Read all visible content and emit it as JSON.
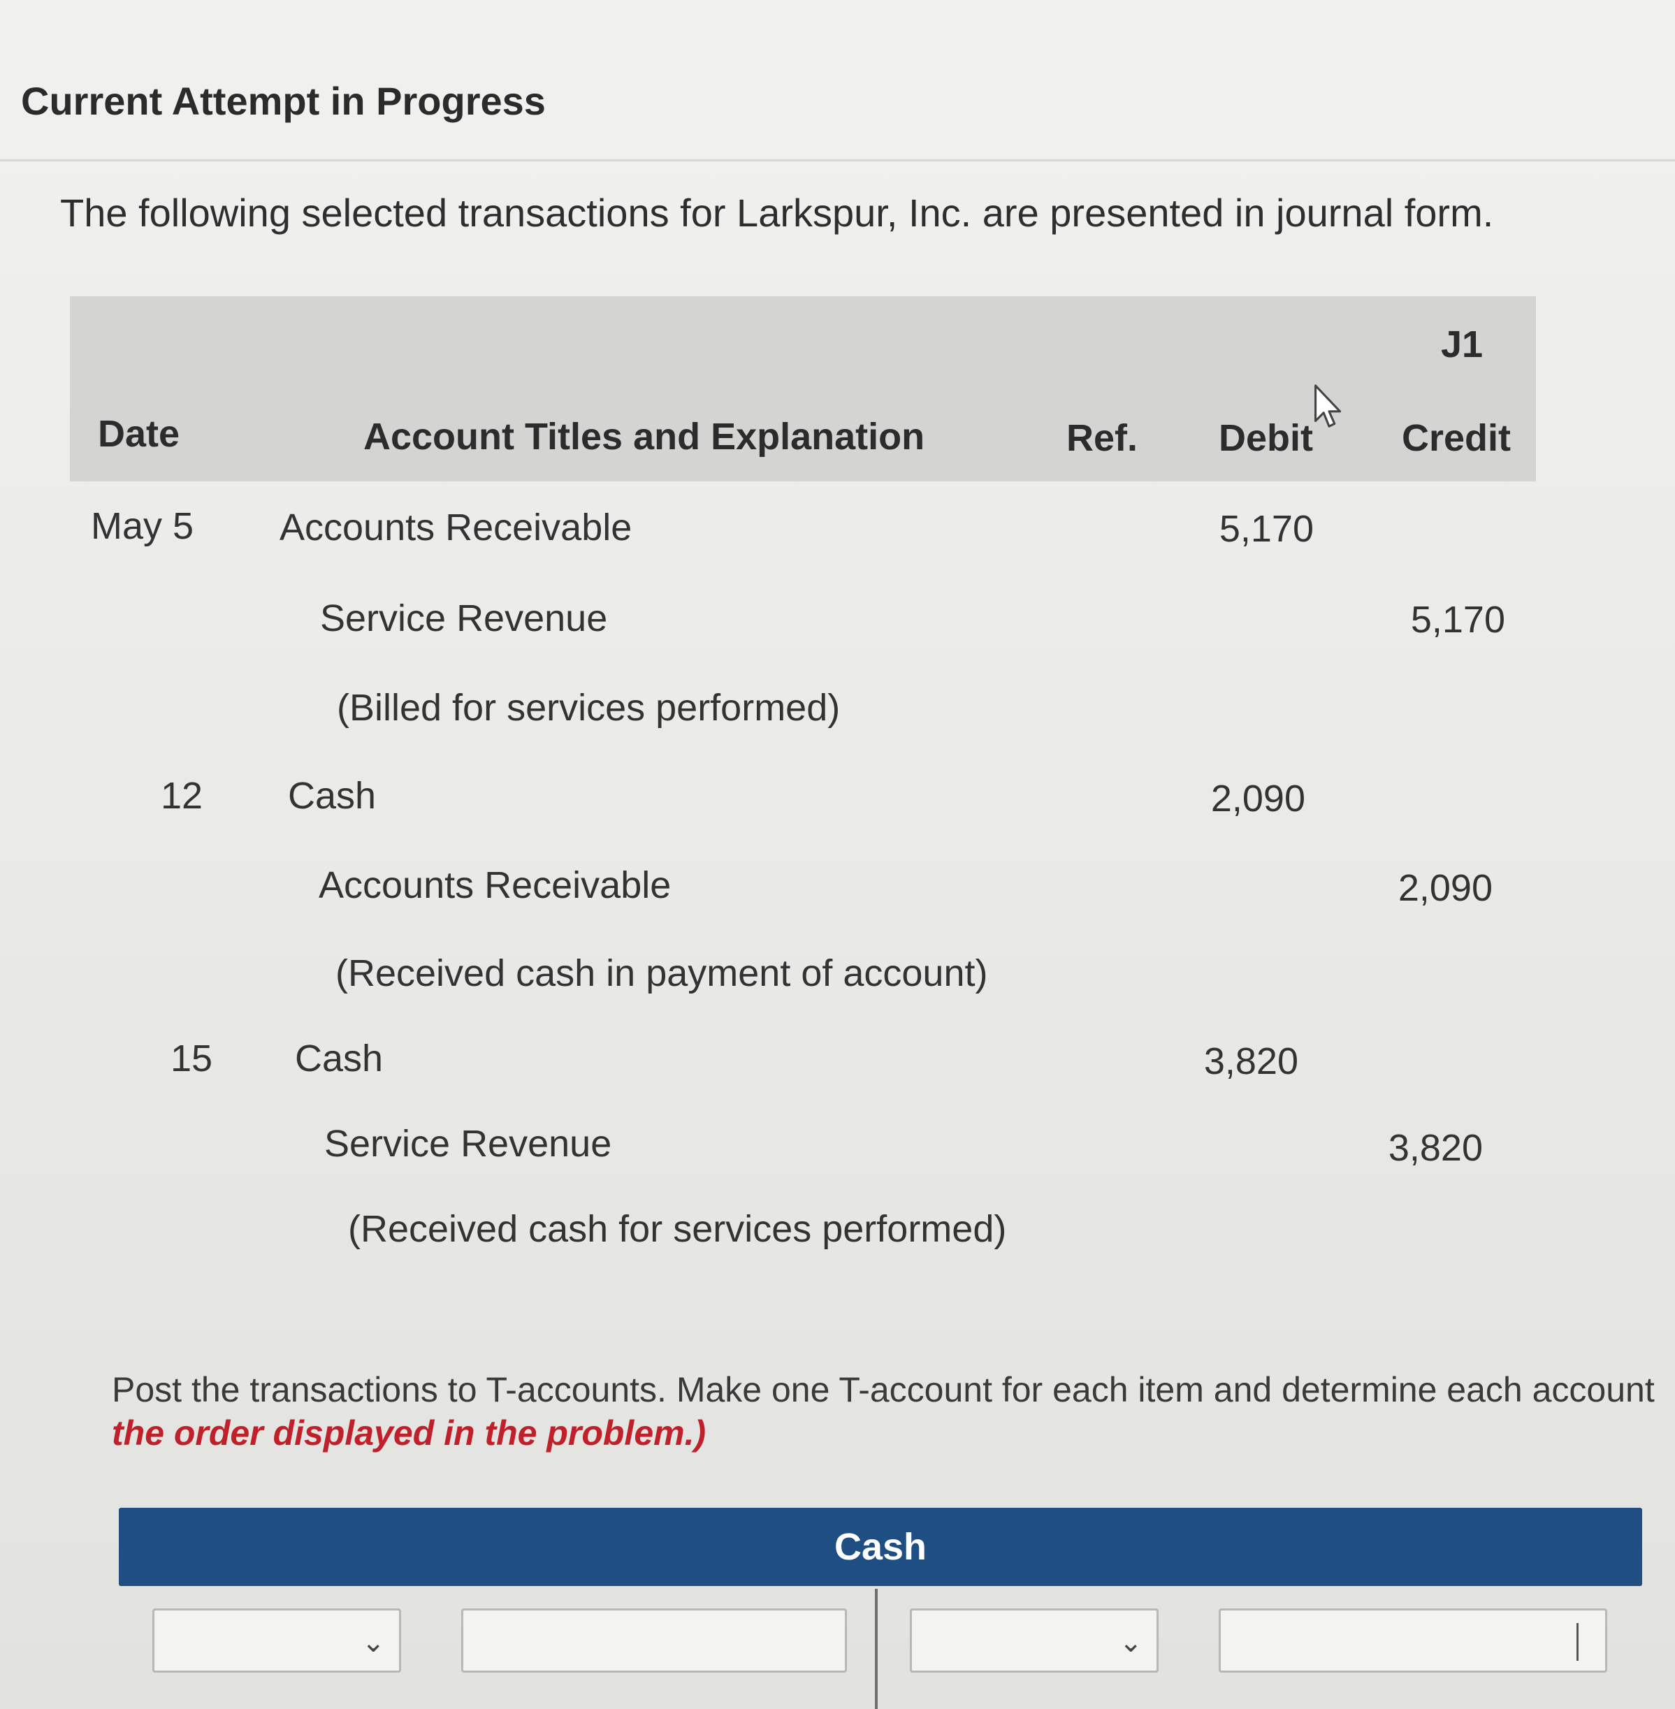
{
  "page": {
    "heading": "Current Attempt in Progress",
    "intro": "The following selected transactions for Larkspur, Inc. are presented in journal form."
  },
  "journal": {
    "page_ref": "J1",
    "headers": {
      "date": "Date",
      "account": "Account Titles and Explanation",
      "ref": "Ref.",
      "debit": "Debit",
      "credit": "Credit"
    },
    "rows": [
      {
        "date": "May 5",
        "account": "Accounts Receivable",
        "debit": "5,170",
        "credit": ""
      },
      {
        "date": "",
        "account": "Service Revenue",
        "debit": "",
        "credit": "5,170"
      },
      {
        "date": "",
        "account": "(Billed for services performed)",
        "debit": "",
        "credit": ""
      },
      {
        "date": "12",
        "account": "Cash",
        "debit": "2,090",
        "credit": ""
      },
      {
        "date": "",
        "account": "Accounts Receivable",
        "debit": "",
        "credit": "2,090"
      },
      {
        "date": "",
        "account": "(Received cash in payment of account)",
        "debit": "",
        "credit": ""
      },
      {
        "date": "15",
        "account": "Cash",
        "debit": "3,820",
        "credit": ""
      },
      {
        "date": "",
        "account": "Service Revenue",
        "debit": "",
        "credit": "3,820"
      },
      {
        "date": "",
        "account": "(Received cash for services performed)",
        "debit": "",
        "credit": ""
      }
    ]
  },
  "instruction": {
    "text": "Post the transactions to T-accounts. Make one T-account for each item and determine each account",
    "emphasis": "the order displayed in the problem.)"
  },
  "taccount": {
    "title": "Cash",
    "left_select_value": "",
    "left_amount_value": "",
    "right_select_value": "",
    "right_amount_value": ""
  },
  "colors": {
    "header_bg": "#d4d4d2",
    "taccount_bar": "#1f4f82",
    "emphasis_red": "#c0202a"
  },
  "icons": {
    "cursor": "mouse-pointer-icon",
    "dropdown": "chevron-down-icon"
  }
}
